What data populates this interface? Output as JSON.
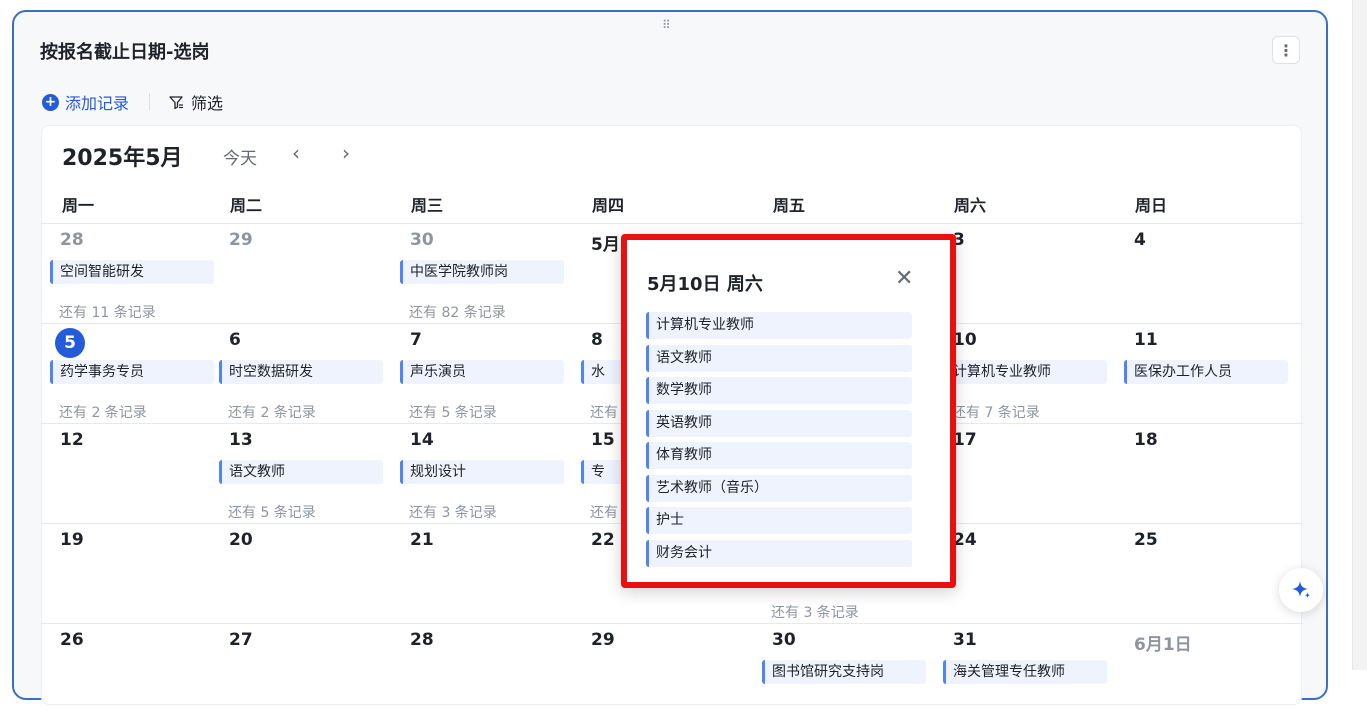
{
  "card": {
    "title": "按报名截止日期-选岗",
    "more_icon": "⋮",
    "drag_icon": "⠿"
  },
  "toolbar": {
    "add_label": "添加记录",
    "filter_label": "筛选"
  },
  "calendar": {
    "month_title": "2025年5月",
    "today_label": "今天",
    "prev_icon": "‹",
    "next_icon": "›",
    "weekdays": [
      "周一",
      "周二",
      "周三",
      "周四",
      "周五",
      "周六",
      "周日"
    ],
    "weeks": [
      [
        {
          "day": "28",
          "other": true,
          "event": "空间智能研发",
          "more": "还有 11 条记录"
        },
        {
          "day": "29",
          "other": true,
          "event": "",
          "more": ""
        },
        {
          "day": "30",
          "other": true,
          "event": "中医学院教师岗",
          "more": "还有 82 条记录"
        },
        {
          "day": "5月",
          "other": false,
          "event": "",
          "more": ""
        },
        {
          "day": "",
          "other": false,
          "event": "",
          "more": ""
        },
        {
          "day": "3",
          "other": false,
          "event": "",
          "more": ""
        },
        {
          "day": "4",
          "other": false,
          "event": "",
          "more": ""
        }
      ],
      [
        {
          "day": "5",
          "today": true,
          "event": "药学事务专员",
          "more": "还有 2 条记录"
        },
        {
          "day": "6",
          "event": "时空数据研发",
          "more": "还有 2 条记录"
        },
        {
          "day": "7",
          "event": "声乐演员",
          "more": "还有 5 条记录"
        },
        {
          "day": "8",
          "event": "水",
          "more": "还有"
        },
        {
          "day": "",
          "event": "",
          "more": ""
        },
        {
          "day": "10",
          "event": "计算机专业教师",
          "more": "还有 7 条记录"
        },
        {
          "day": "11",
          "event": "医保办工作人员",
          "more": ""
        }
      ],
      [
        {
          "day": "12",
          "event": "",
          "more": ""
        },
        {
          "day": "13",
          "event": "语文教师",
          "more": "还有 5 条记录"
        },
        {
          "day": "14",
          "event": "规划设计",
          "more": "还有 3 条记录"
        },
        {
          "day": "15",
          "event": "专",
          "more": "还有"
        },
        {
          "day": "",
          "event": "",
          "more": ""
        },
        {
          "day": "17",
          "event": "",
          "more": ""
        },
        {
          "day": "18",
          "event": "",
          "more": ""
        }
      ],
      [
        {
          "day": "19",
          "event": "",
          "more": ""
        },
        {
          "day": "20",
          "event": "",
          "more": ""
        },
        {
          "day": "21",
          "event": "",
          "more": ""
        },
        {
          "day": "22",
          "event": "",
          "more": ""
        },
        {
          "day": "",
          "event": "",
          "more": "还有 3 条记录"
        },
        {
          "day": "24",
          "event": "",
          "more": ""
        },
        {
          "day": "25",
          "event": "",
          "more": ""
        }
      ],
      [
        {
          "day": "26",
          "event": "",
          "more": ""
        },
        {
          "day": "27",
          "event": "",
          "more": ""
        },
        {
          "day": "28",
          "event": "",
          "more": ""
        },
        {
          "day": "29",
          "event": "",
          "more": ""
        },
        {
          "day": "30",
          "event": "图书馆研究支持岗",
          "more": ""
        },
        {
          "day": "31",
          "event": "海关管理专任教师",
          "more": ""
        },
        {
          "day": "6月1日",
          "other": true,
          "event": "",
          "more": ""
        }
      ]
    ]
  },
  "popup": {
    "title": "5月10日 周六",
    "close_icon": "✕",
    "events": [
      "计算机专业教师",
      "语文教师",
      "数学教师",
      "英语教师",
      "体育教师",
      "艺术教师（音乐）",
      "护士",
      "财务会计"
    ]
  },
  "colors": {
    "accent": "#245bdb",
    "highlight_border": "#e8110e",
    "event_bar": "#4e83fd",
    "event_bg": "#eff3fe"
  }
}
